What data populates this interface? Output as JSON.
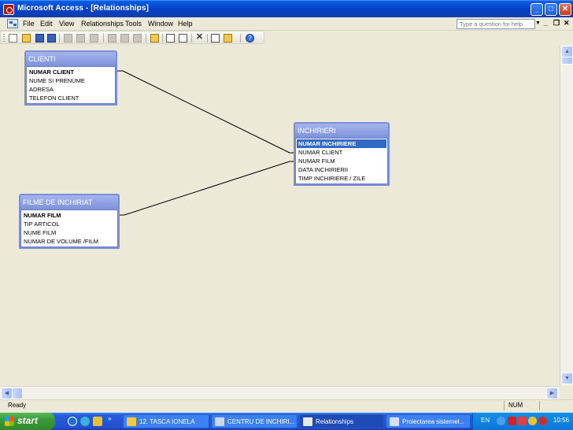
{
  "window": {
    "title": "Microsoft Access - [Relationships]",
    "controls": {
      "minimize": "_",
      "maximize": "□",
      "close": "✕"
    }
  },
  "menubar": {
    "items": [
      {
        "label": "File"
      },
      {
        "label": "Edit"
      },
      {
        "label": "View"
      },
      {
        "label": "Relationships"
      },
      {
        "label": "Tools"
      },
      {
        "label": "Window"
      },
      {
        "label": "Help"
      }
    ],
    "help_placeholder": "Type a question for help",
    "mdi": {
      "minimize": "_",
      "restore": "❐",
      "close": "✕"
    }
  },
  "toolbar": {
    "icons": [
      "new-icon",
      "open-icon",
      "save-icon",
      "save-as-icon",
      "print-icon",
      "print-preview-icon",
      "spelling-icon",
      "cut-icon",
      "copy-icon",
      "paste-icon",
      "show-table-icon",
      "show-direct-icon",
      "show-all-icon",
      "delete-icon",
      "relationships-icon",
      "new-object-icon",
      "help-icon"
    ]
  },
  "tables": {
    "clienti": {
      "title": "CLIENTI",
      "fields": [
        "NUMAR CLIENT",
        "NUME SI PRENUME",
        "ADRESA",
        "TELEFON CLIENT"
      ]
    },
    "inchirieri": {
      "title": "INCHIRIERI",
      "fields": [
        "NUMAR INCHIRIERE",
        "NUMAR CLIENT",
        "NUMAR FILM",
        "DATA INCHIRIERII",
        "TIMP INCHIRIERE / ZILE"
      ]
    },
    "filme": {
      "title": "FILME DE INCHIRIAT",
      "fields": [
        "NUMAR FILM",
        "TIP ARTICOL",
        "NUME FILM",
        "NUMAR DE VOLUME /FILM"
      ]
    }
  },
  "statusbar": {
    "status": "Ready",
    "num": "NUM"
  },
  "taskbar": {
    "start_label": "start",
    "quick_launch_more": "»",
    "tasks": [
      {
        "label": "12. TASCA IONELA",
        "color": "#f0c850"
      },
      {
        "label": "CENTRU DE INCHIRI...",
        "color": "#c8d8f0"
      },
      {
        "label": "Relationships",
        "color": "#e8e8e8"
      },
      {
        "label": "Proiectarea sistemel...",
        "color": "#d8e0f0"
      }
    ],
    "language": "EN",
    "clock": "10:56"
  }
}
